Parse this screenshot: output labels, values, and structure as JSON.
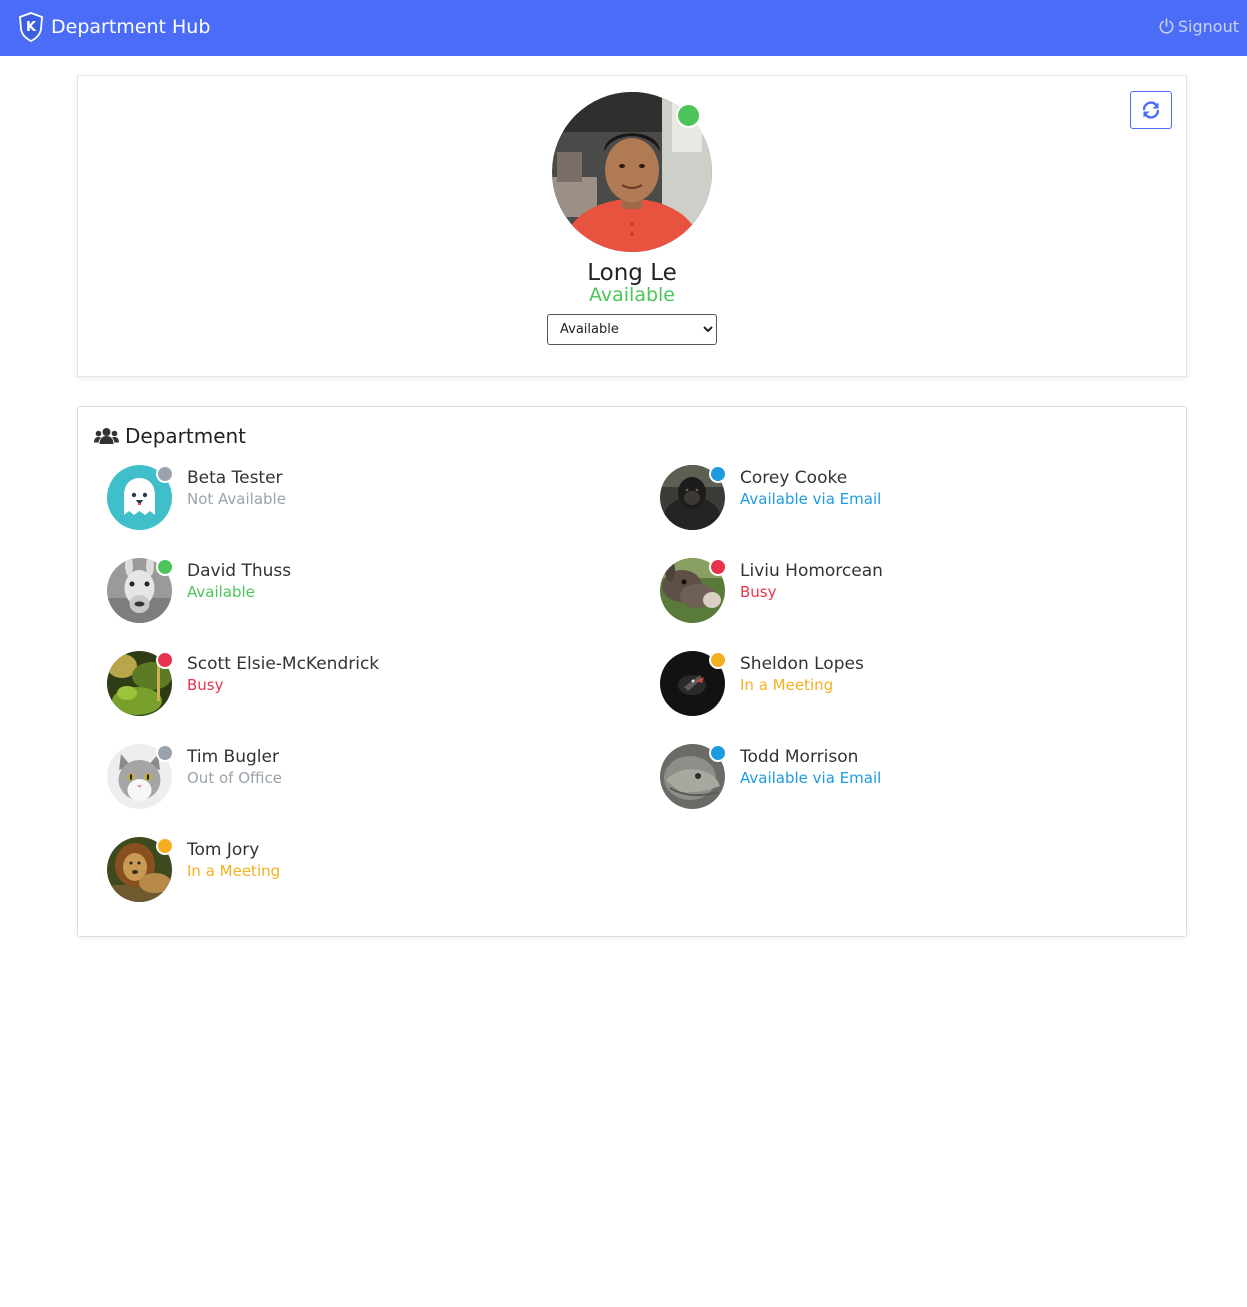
{
  "app": {
    "title": "Department Hub",
    "signout_label": "Signout"
  },
  "profile": {
    "name": "Long Le",
    "status": "Available",
    "status_color": "#4cc45a",
    "selected_status": "Available"
  },
  "department": {
    "title": "Department",
    "members": [
      {
        "name": "Beta Tester",
        "status": "Not Available",
        "status_color": "#9aa3ab",
        "avatar": "ghost-avatar"
      },
      {
        "name": "Corey Cooke",
        "status": "Available via Email",
        "status_color": "#1e9be0",
        "avatar": "gorilla-photo"
      },
      {
        "name": "David Thuss",
        "status": "Available",
        "status_color": "#4cc45a",
        "avatar": "llama-photo"
      },
      {
        "name": "Liviu Homorcean",
        "status": "Busy",
        "status_color": "#e8334f",
        "avatar": "donkey-photo"
      },
      {
        "name": "Scott Elsie-McKendrick",
        "status": "Busy",
        "status_color": "#e8334f",
        "avatar": "forest-photo"
      },
      {
        "name": "Sheldon Lopes",
        "status": "In a Meeting",
        "status_color": "#f5b021",
        "avatar": "bird-photo"
      },
      {
        "name": "Tim Bugler",
        "status": "Out of Office",
        "status_color": "#9aa3ab",
        "avatar": "cat-photo"
      },
      {
        "name": "Todd Morrison",
        "status": "Available via Email",
        "status_color": "#1e9be0",
        "avatar": "iguana-photo"
      },
      {
        "name": "Tom Jory",
        "status": "In a Meeting",
        "status_color": "#f5b021",
        "avatar": "lion-photo"
      }
    ]
  },
  "colors": {
    "navbar": "#4a6cf7",
    "available": "#4cc45a",
    "busy": "#e8334f",
    "meeting": "#f5b021",
    "email": "#1e9be0",
    "away": "#9aa3ab"
  }
}
